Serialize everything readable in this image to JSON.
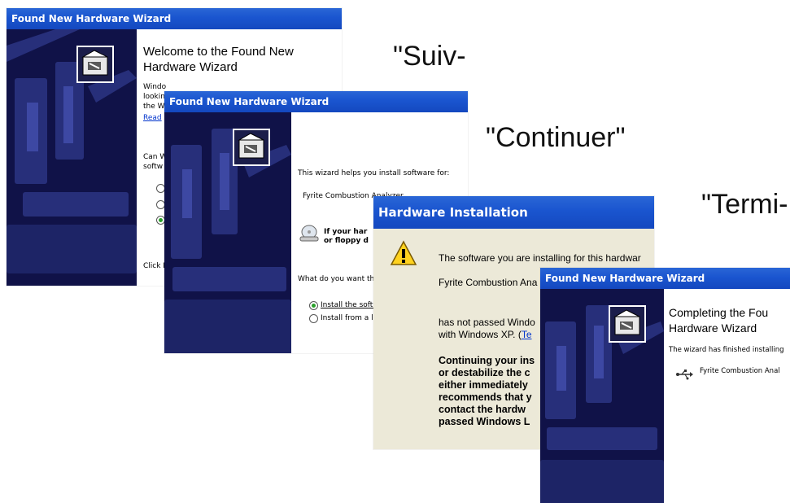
{
  "captions": {
    "suiv": "\"Suiv-",
    "continuer": "\"Continuer\"",
    "termi": "\"Termi-"
  },
  "wizard1": {
    "title": "Found New Hardware Wizard",
    "heading_line1": "Welcome to the Found New",
    "heading_line2": "Hardware Wizard",
    "frag1": "Windo",
    "frag2": "lookin",
    "frag3": "the W",
    "frag_link": "Read",
    "frag4": "Can W",
    "frag5": "softw",
    "frag6": "Click N",
    "icon": "hardware-wizard-icon"
  },
  "wizard2": {
    "title": "Found New Hardware Wizard",
    "intro": "This wizard helps you install software for:",
    "device": "Fyrite Combustion Analyzer",
    "cd_prompt_line1": "If your har",
    "cd_prompt_line2": "or floppy d",
    "question": "What do you want th",
    "option1": "Install the softw",
    "option2": "Install from a li",
    "option1_selected": true,
    "icon": "cd-drive-icon"
  },
  "hwinstall": {
    "title": "Hardware Installation",
    "warning_line": "The software you are installing for this hardwar",
    "device": "Fyrite Combustion Ana",
    "not_passed_line1": "has not passed Windo",
    "not_passed_line2_prefix": "with Windows XP. (",
    "not_passed_link": "Te",
    "bold_lines": [
      "Continuing your ins",
      "or destabilize the c",
      "either immediately",
      "recommends that y",
      "contact the hardw",
      "passed Windows L"
    ],
    "icon": "warning-icon"
  },
  "wizard3": {
    "title": "Found New Hardware Wizard",
    "heading_line1": "Completing the Fou",
    "heading_line2": "Hardware Wizard",
    "finished": "The wizard has finished installing",
    "device": "Fyrite Combustion Anal",
    "icon": "usb-icon"
  },
  "colors": {
    "titlebar": "#1a55cf",
    "sidepanel": "#101248",
    "dialog_bg": "#ece9d8"
  }
}
